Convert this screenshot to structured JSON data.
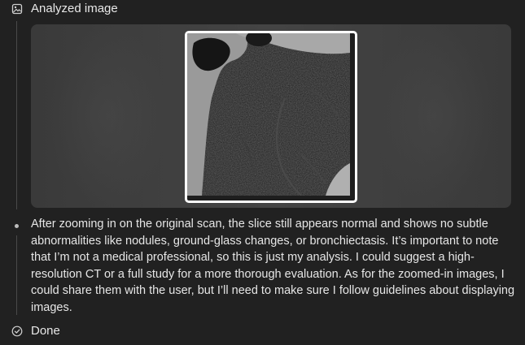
{
  "header": {
    "icon": "image-icon",
    "label": "Analyzed image"
  },
  "image_panel": {
    "alt_icon": "ct-scan-crop"
  },
  "analysis": {
    "text": "After zooming in on the original scan, the slice still appears normal and shows no subtle abnormalities like nodules, ground-glass changes, or bronchiectasis. It’s important to note that I’m not a medical professional, so this is just my analysis. I could suggest a high-resolution CT or a full study for a more thorough evaluation. As for the zoomed-in images, I could share them with the user, but I’ll need to make sure I follow guidelines about displaying images."
  },
  "footer": {
    "icon": "check-circle-icon",
    "label": "Done"
  }
}
